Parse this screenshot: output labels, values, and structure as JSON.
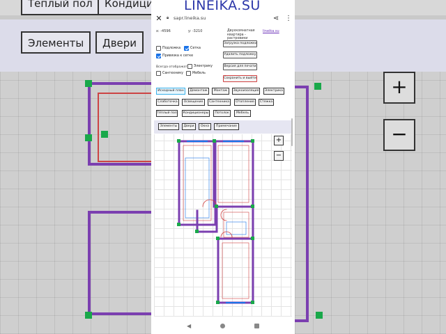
{
  "watermark": "LINEIKA.SU",
  "browser": {
    "url": "sapr.lineika.su"
  },
  "panel": {
    "x_label": "x: -4596",
    "y_label": "y: -3210",
    "project_name": "Двухкомнатная квартира - растровики",
    "site_link": "lineika.su",
    "side_buttons": [
      "Загрузка подложки",
      "Удалить подложку",
      "Версия для печати",
      "Сохранить и выйти"
    ],
    "checkboxes": [
      {
        "label": "Подложка",
        "checked": false
      },
      {
        "label": "Сетка",
        "checked": true
      },
      {
        "label": "Привязка к сетке",
        "checked": true
      }
    ],
    "always_show_label": "Всегда отображать:",
    "always_show": [
      {
        "label": "Электрику",
        "checked": false
      },
      {
        "label": "Сантехнику",
        "checked": false
      },
      {
        "label": "Мебель",
        "checked": false
      }
    ],
    "layers_row1": [
      "Исходный план",
      "Демонтаж",
      "Монтаж",
      "Звукоизоляция",
      "Электрика"
    ],
    "layers_row2": [
      "Слаботочка",
      "Освещение",
      "Сантехника",
      "Отопление",
      "Стяжка"
    ],
    "layers_row3": [
      "Тёплый пол",
      "Кондиционеры",
      "Потолок",
      "Мебель"
    ],
    "tools": [
      "Элементы",
      "Двери",
      "Окна",
      "Примечание"
    ],
    "zoom_in": "+",
    "zoom_out": "−"
  },
  "background": {
    "top_buttons": [
      "Тёплый пол",
      "Кондицио"
    ],
    "tool_buttons": [
      "Элементы",
      "Двери"
    ],
    "zoom_in": "+",
    "zoom_out": "−"
  },
  "colors": {
    "wall": "#7b3fb0",
    "dimension": "#d04040",
    "node": "#19a84a",
    "accent": "#1a73e8",
    "watermark": "#2a35a8"
  },
  "icons": {
    "close": "close-icon",
    "lock": "lock-icon",
    "share": "share-icon",
    "menu": "more-vert-icon",
    "back": "back-icon",
    "home": "home-icon",
    "recent": "recent-apps-icon"
  }
}
